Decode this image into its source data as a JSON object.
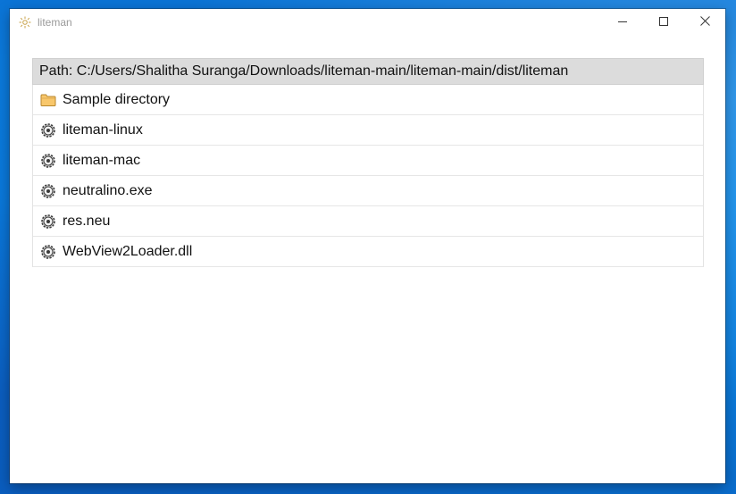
{
  "window": {
    "title": "liteman",
    "app_icon": "sun-icon"
  },
  "caption": {
    "minimize_icon": "minimize-icon",
    "maximize_icon": "maximize-icon",
    "close_icon": "close-icon"
  },
  "path_bar": {
    "text": "Path: C:/Users/Shalitha Suranga/Downloads/liteman-main/liteman-main/dist/liteman"
  },
  "files": [
    {
      "name": "Sample directory",
      "icon": "folder-icon"
    },
    {
      "name": "liteman-linux",
      "icon": "gear-icon"
    },
    {
      "name": "liteman-mac",
      "icon": "gear-icon"
    },
    {
      "name": "neutralino.exe",
      "icon": "gear-icon"
    },
    {
      "name": "res.neu",
      "icon": "gear-icon"
    },
    {
      "name": "WebView2Loader.dll",
      "icon": "gear-icon"
    }
  ],
  "colors": {
    "path_bar_bg": "#dcdcdc",
    "folder": "#f8c76b",
    "desktop_accent": "#0a86e8"
  }
}
